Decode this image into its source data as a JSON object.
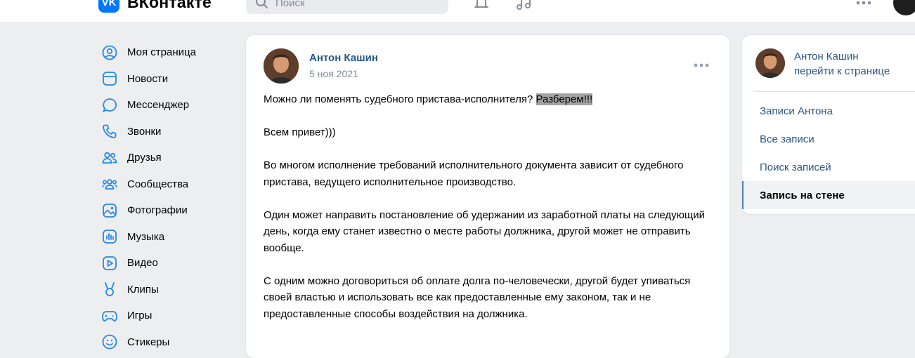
{
  "header": {
    "logo_badge": "VK",
    "logo_text": "ВКонтакте",
    "search_placeholder": "Поиск"
  },
  "nav": {
    "items": [
      {
        "label": "Моя страница",
        "icon": "user-circle-icon"
      },
      {
        "label": "Новости",
        "icon": "news-icon"
      },
      {
        "label": "Мессенджер",
        "icon": "chat-bubble-icon"
      },
      {
        "label": "Звонки",
        "icon": "phone-icon"
      },
      {
        "label": "Друзья",
        "icon": "friends-icon"
      },
      {
        "label": "Сообщества",
        "icon": "communities-icon"
      },
      {
        "label": "Фотографии",
        "icon": "photo-icon"
      },
      {
        "label": "Музыка",
        "icon": "music-icon"
      },
      {
        "label": "Видео",
        "icon": "video-icon"
      },
      {
        "label": "Клипы",
        "icon": "clips-icon"
      },
      {
        "label": "Игры",
        "icon": "gamepad-icon"
      },
      {
        "label": "Стикеры",
        "icon": "sticker-icon"
      }
    ]
  },
  "post": {
    "author": "Антон Кашин",
    "date": "5 ноя 2021",
    "title_plain": "Можно ли поменять судебного пристава-исполнителя?",
    "title_highlight": "Разберем!!!",
    "paragraphs": [
      "Всем привет)))",
      "Во многом исполнение требований исполнительного документа зависит от судебного пристава, ведущего исполнительное производство.",
      "Один может направить постановление об удержании из заработной платы на следующий день, когда ему станет известно о месте работы должника, другой может не отправить вообще.",
      "С одним можно договориться об оплате долга по-человечески, другой будет упиваться своей властью и использовать все как предоставленные ему законом, так и не предоставленные способы воздействия на должника."
    ]
  },
  "side": {
    "name": "Антон Кашин",
    "link": "перейти к странице",
    "menu": [
      {
        "label": "Записи Антона",
        "active": false
      },
      {
        "label": "Все записи",
        "active": false
      },
      {
        "label": "Поиск записей",
        "active": false
      },
      {
        "label": "Запись на стене",
        "active": true
      }
    ]
  },
  "colors": {
    "accent": "#0077ff",
    "link": "#2a5885",
    "icon": "#2688eb",
    "highlight": "#a3a3a3"
  }
}
